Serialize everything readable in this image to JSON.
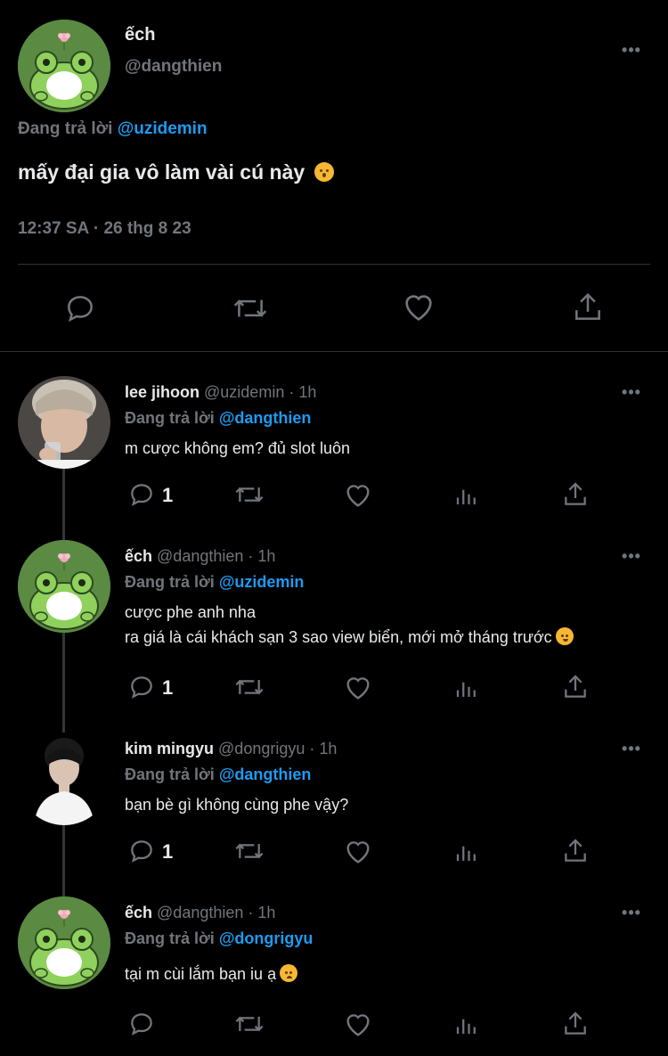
{
  "main_tweet": {
    "display_name": "ếch",
    "handle": "@dangthien",
    "replying_prefix": "Đang trả lời ",
    "replying_to": "@uzidemin",
    "text": "mấy đại gia vô làm vài cú này",
    "text_emoji": "hushed-face",
    "timestamp": "12:37 SA · 26 thg 8 23",
    "more_label": "•••"
  },
  "replies": [
    {
      "display_name": "lee jihoon",
      "meta": " @uzidemin · 1h",
      "replying_prefix": "Đang trả lời ",
      "replying_to": "@dangthien",
      "lines": [
        "m cược không em? đủ slot luôn"
      ],
      "reply_count": "1",
      "avatar": "photo-person-glass"
    },
    {
      "display_name": "ếch",
      "meta": " @dangthien · 1h",
      "replying_prefix": "Đang trả lời ",
      "replying_to": "@uzidemin",
      "lines": [
        "cược phe anh nha",
        "ra giá là cái khách sạn 3 sao view biển, mới mở tháng trước"
      ],
      "line_emoji": "face-with-hand-over-mouth",
      "reply_count": "1",
      "avatar": "frog"
    },
    {
      "display_name": "kim mingyu",
      "meta": " @dongrigyu · 1h",
      "replying_prefix": "Đang trả lời ",
      "replying_to": "@dangthien",
      "lines": [
        "bạn bè gì không cùng phe vậy?"
      ],
      "reply_count": "1",
      "avatar": "photo-person-white"
    },
    {
      "display_name": "ếch",
      "meta": " @dangthien · 1h",
      "replying_prefix": "Đang trả lời ",
      "replying_to": "@dongrigyu",
      "lines": [
        "tại m cùi lắm bạn iu ạ"
      ],
      "line_emoji": "relieved-face",
      "reply_count": "",
      "avatar": "frog"
    }
  ],
  "more_label": "•••",
  "colors": {
    "background": "#000000",
    "text": "#e7e9ea",
    "secondary": "#71767b",
    "mention": "#1d9bf0",
    "divider": "#2f3336",
    "frog_avatar_bg": "#5b8a43"
  }
}
